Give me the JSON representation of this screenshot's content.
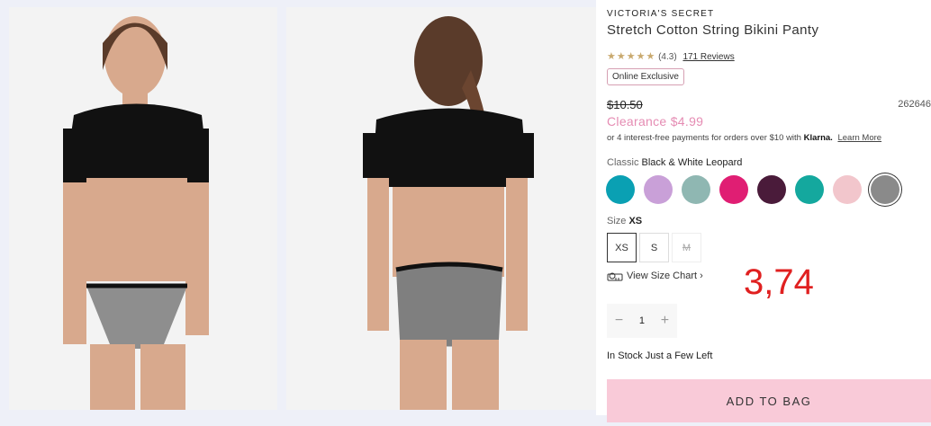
{
  "product": {
    "brand": "VICTORIA'S SECRET",
    "title": "Stretch Cotton String Bikini Panty",
    "stars": "★★★★★",
    "rating_text": "(4.3)",
    "reviews": "171 Reviews",
    "badge": "Online Exclusive",
    "old_price": "$10.50",
    "sku": "262646",
    "clearance": "Clearance $4.99",
    "klarna_text": "or 4 interest-free payments for orders over $10 with",
    "klarna_brand": "Klarna.",
    "klarna_link": "Learn More",
    "color_label": "Classic",
    "color_value": "Black & White Leopard",
    "size_label": "Size",
    "size_value": "XS",
    "sizes": [
      "XS",
      "S",
      "M"
    ],
    "size_chart": "View Size Chart ›",
    "qty_minus": "−",
    "qty": "1",
    "qty_plus": "+",
    "stock": "In Stock Just a Few Left",
    "add_to_bag": "ADD TO BAG"
  },
  "swatches": [
    {
      "name": "teal-floral",
      "color": "#0aa0b3"
    },
    {
      "name": "lavender-floral",
      "color": "#c9a0d8"
    },
    {
      "name": "sage",
      "color": "#8fb7b2"
    },
    {
      "name": "fuchsia",
      "color": "#e01e73"
    },
    {
      "name": "black-floral",
      "color": "#4a1b3a"
    },
    {
      "name": "teal",
      "color": "#14a89e"
    },
    {
      "name": "pink-print",
      "color": "#f2c6cc"
    },
    {
      "name": "black-white-leopard",
      "color": "#8a8a8a"
    }
  ],
  "annotation": "3,74"
}
